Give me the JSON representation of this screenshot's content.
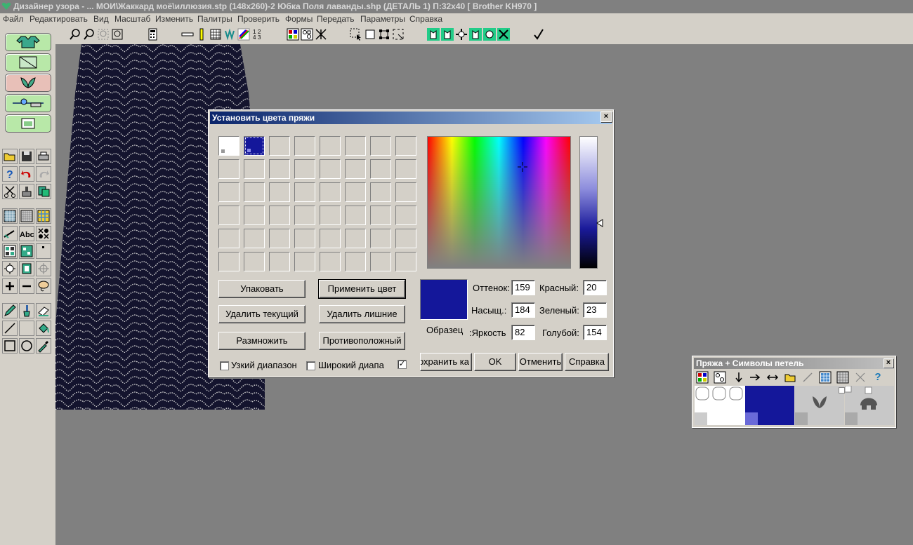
{
  "window": {
    "title": "Дизайнер узора - ... МОИ\\Жаккард моё\\иллюзия.stp (148x260)-2    Юбка Поля лаванды.shp (ДЕТАЛЬ  1)    П:32x40    [ Brother KH970 ]"
  },
  "menu": {
    "items": [
      "Файл",
      "Редактировать",
      "Вид",
      "Масштаб",
      "Изменить",
      "Палитры",
      "Проверить",
      "Формы",
      "Передать",
      "Параметры",
      "Справка"
    ]
  },
  "dialog": {
    "title": "Установить цвета пряжи",
    "close": "×",
    "buttons": {
      "pack": "Упаковать",
      "apply": "Применить цвет",
      "delete_current": "Удалить текущий",
      "delete_extra": "Удалить лишние",
      "multiply": "Размножить",
      "opposite": "Противоположный",
      "save": "охранить ка",
      "ok": "OK",
      "cancel": "Отменить",
      "help": "Справка"
    },
    "checkboxes": {
      "narrow": "Узкий диапазон",
      "wide": "Широкий диапа",
      "third_checked": "✓"
    },
    "sample_label": "Образец",
    "fields": {
      "hue_label": "Оттенок:",
      "hue": "159",
      "sat_label": "Насыщ.:",
      "sat": "184",
      "bright_label": "Яркость:",
      "bright": "82",
      "red_label": "Красный:",
      "red": "20",
      "green_label": "Зеленый:",
      "green": "23",
      "blue_label": "Голубой:",
      "blue": "154"
    },
    "colors": {
      "slot1": "#ffffff",
      "slot2": "#14179a",
      "sample": "#14179a"
    }
  },
  "yarn_panel": {
    "title": "Пряжа + Символы петель",
    "close": "×",
    "help": "?"
  },
  "colors": {
    "selected_yarn": "#14179a",
    "pattern_bg": "#14142e",
    "pattern_lines": "#cfcfcf"
  }
}
